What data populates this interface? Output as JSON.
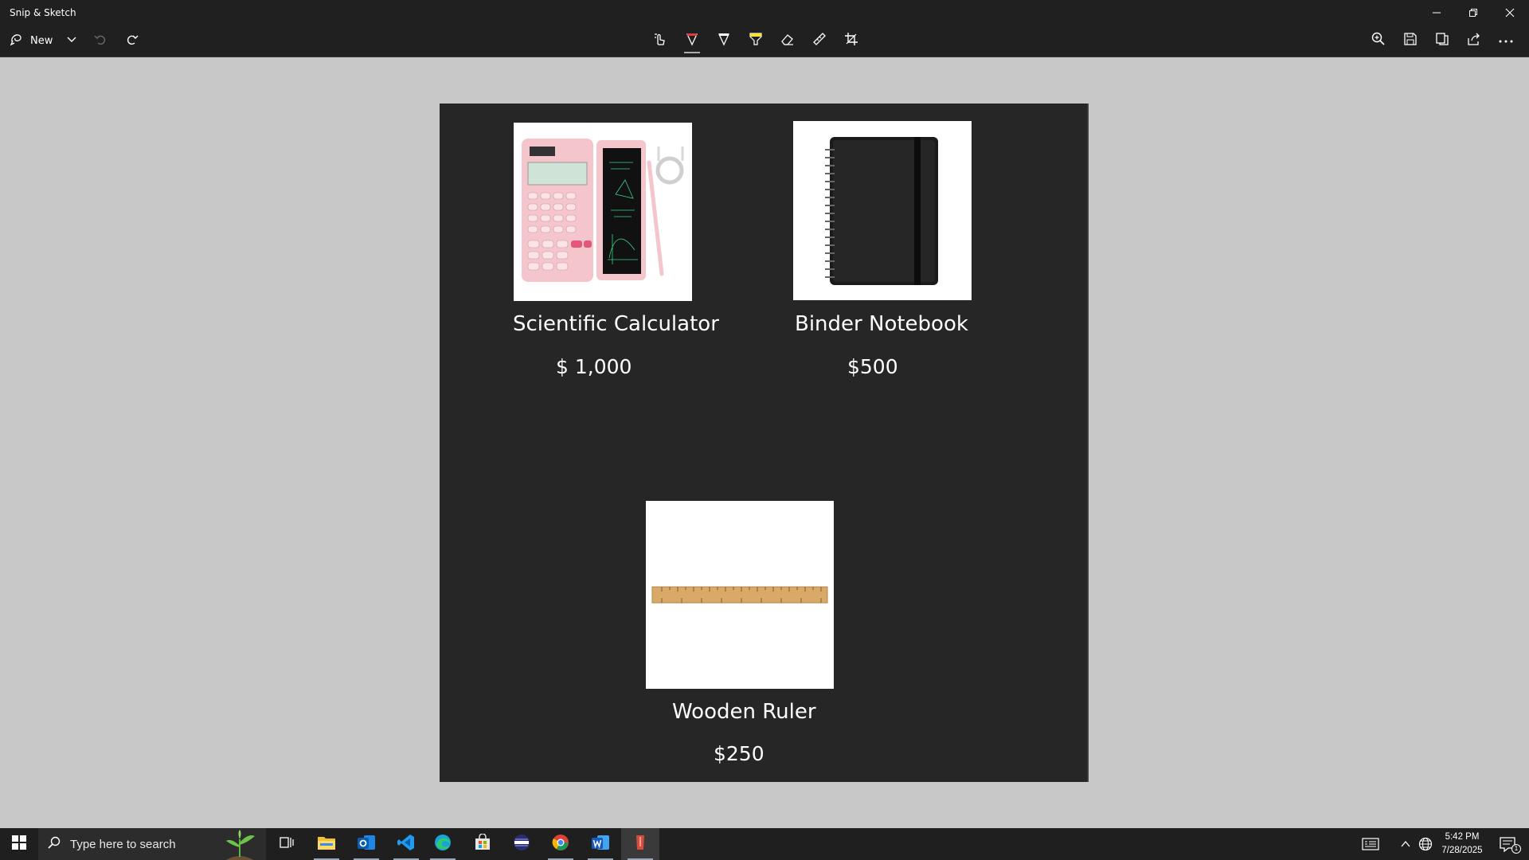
{
  "window": {
    "title": "Snip & Sketch"
  },
  "toolbar": {
    "new_label": "New",
    "icons": [
      "new-snip-icon",
      "dropdown-chevron-icon",
      "undo-icon",
      "redo-icon",
      "touch-writing-icon",
      "ballpoint-pen-icon",
      "pencil-icon",
      "highlighter-icon",
      "eraser-icon",
      "ruler-icon",
      "crop-icon",
      "zoom-icon",
      "save-icon",
      "copy-icon",
      "share-icon",
      "more-icon"
    ],
    "pen_color": "#e03c3c",
    "highlighter_color": "#f5e23b"
  },
  "products": [
    {
      "name": "Scientific Calculator",
      "price": "$ 1,000"
    },
    {
      "name": "Binder Notebook",
      "price": "$500"
    },
    {
      "name": "Wooden Ruler",
      "price": "$250"
    }
  ],
  "taskbar": {
    "search_placeholder": "Type here to search",
    "apps": [
      "task-view",
      "file-explorer",
      "outlook",
      "vs-code",
      "edge",
      "store",
      "browser",
      "chrome",
      "word",
      "snip-and-sketch"
    ],
    "time": "5:42 PM",
    "date": "7/28/2025",
    "notification_count": "1"
  }
}
